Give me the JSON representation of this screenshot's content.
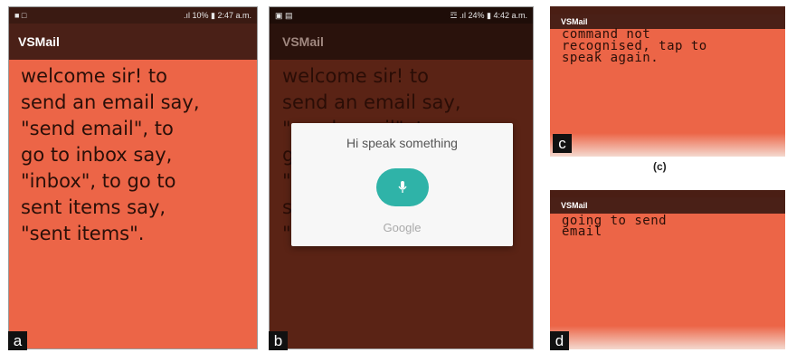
{
  "panels": {
    "a": {
      "label": "a",
      "status": {
        "left": "■ □",
        "right": ".ıl 10% ▮ 2:47 a.m."
      },
      "app_title": "VSMail",
      "message": "welcome sir! to\nsend an email say,\n\"send email\", to\ngo to inbox say,\n\"inbox\", to go to\nsent items say,\n\"sent items\"."
    },
    "b": {
      "label": "b",
      "status": {
        "left": "▣ ▤",
        "right": "☲ .ıl 24% ▮ 4:42 a.m."
      },
      "app_title": "VSMail",
      "message": "welcome sir! to\nsend an email say,\n\"send email\", to\ngo to inbox say,\n\"inbox\", to go to\nsent items say,\n\"sent items\".",
      "dialog": {
        "prompt": "Hi speak something",
        "brand": "Google",
        "mic_icon": "microphone-icon"
      }
    },
    "c": {
      "label": "c",
      "caption": "(c)",
      "app_title": "VSMail",
      "message": "command not\nrecognised, tap to\nspeak again."
    },
    "d": {
      "label": "d",
      "app_title": "VSMail",
      "message": "going to send\nemail"
    }
  },
  "colors": {
    "screen_bg": "#ec6547",
    "status_bar": "#3a1a12",
    "app_bar": "#4a2017",
    "overlay_bg": "#5a2315",
    "mic_button": "#2fb3a8"
  }
}
